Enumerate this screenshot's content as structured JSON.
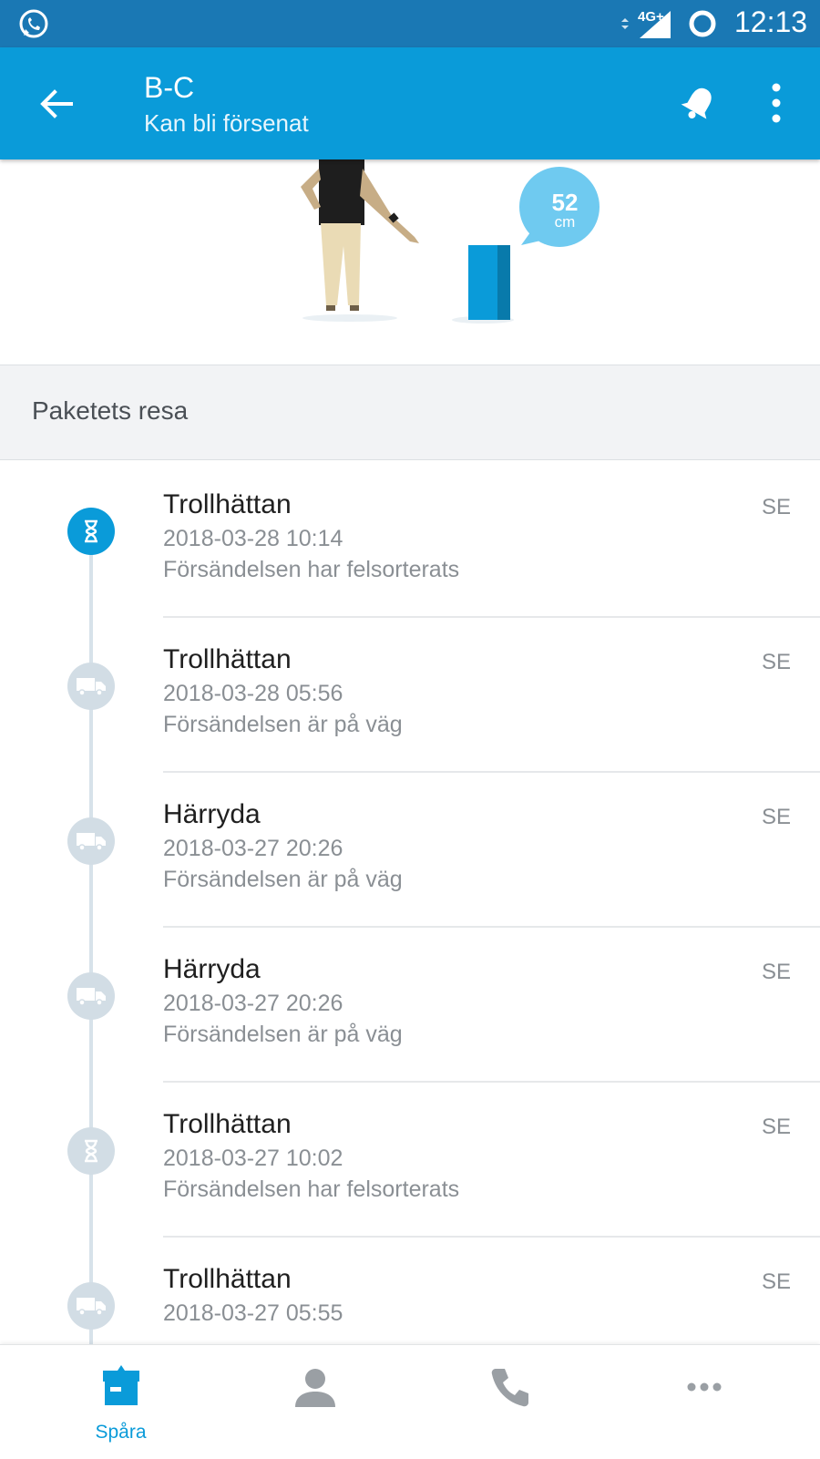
{
  "status_bar": {
    "network_label": "4G+",
    "time": "12:13",
    "icons": [
      "whatsapp-icon",
      "signal-icon",
      "battery-icon"
    ]
  },
  "app_bar": {
    "title": "B-C",
    "subtitle": "Kan bli försenat",
    "icons": [
      "back-arrow-icon",
      "bell-icon",
      "more-vert-icon"
    ]
  },
  "illustration": {
    "size_value": "52",
    "size_unit": "cm"
  },
  "section": {
    "title": "Paketets resa"
  },
  "events": [
    {
      "place": "Trollhättan",
      "time": "2018-03-28 10:14",
      "description": "Försändelsen har felsorterats",
      "country": "SE",
      "icon": "hourglass-icon",
      "active": true
    },
    {
      "place": "Trollhättan",
      "time": "2018-03-28 05:56",
      "description": "Försändelsen är på väg",
      "country": "SE",
      "icon": "truck-icon",
      "active": false
    },
    {
      "place": "Härryda",
      "time": "2018-03-27 20:26",
      "description": "Försändelsen är på väg",
      "country": "SE",
      "icon": "truck-icon",
      "active": false
    },
    {
      "place": "Härryda",
      "time": "2018-03-27 20:26",
      "description": "Försändelsen är på väg",
      "country": "SE",
      "icon": "truck-icon",
      "active": false
    },
    {
      "place": "Trollhättan",
      "time": "2018-03-27 10:02",
      "description": "Försändelsen har felsorterats",
      "country": "SE",
      "icon": "hourglass-icon",
      "active": false
    },
    {
      "place": "Trollhättan",
      "time": "2018-03-27 05:55",
      "description": "",
      "country": "SE",
      "icon": "truck-icon",
      "active": false
    }
  ],
  "bottom_nav": {
    "items": [
      {
        "label": "Spåra",
        "icon": "package-icon",
        "active": true
      },
      {
        "label": "",
        "icon": "person-icon",
        "active": false
      },
      {
        "label": "",
        "icon": "phone-icon",
        "active": false
      },
      {
        "label": "",
        "icon": "more-horiz-icon",
        "active": false
      }
    ]
  },
  "colors": {
    "status_bar": "#1a78b4",
    "app_bar": "#0a9bd9",
    "accent": "#0a9bd9",
    "inactive_dot": "#d2dde5",
    "inactive_icon": "#9a9fa4"
  }
}
